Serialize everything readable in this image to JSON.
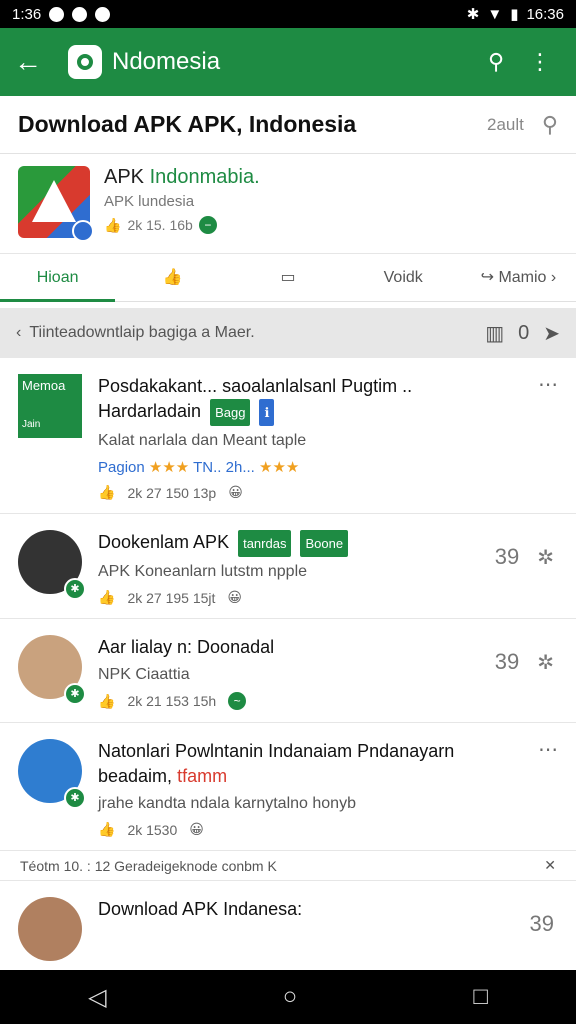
{
  "status": {
    "time": "1:36",
    "right_time": "16:36"
  },
  "appbar": {
    "title": "Ndomesia"
  },
  "search": {
    "query": "Download APK APK, Indonesia",
    "meta": "2ault"
  },
  "app": {
    "name_a": "APK",
    "name_b": "Indonmabia.",
    "sub": "APK lundesia",
    "stats": "2k  15. 16b"
  },
  "tabs": [
    {
      "label": "Hioan"
    },
    {
      "label": ""
    },
    {
      "label": ""
    },
    {
      "label": "Voidk"
    },
    {
      "label": "Mamio"
    }
  ],
  "notice": {
    "text": "Tiinteadowntlaip bagiga a Maer.",
    "count": "0"
  },
  "posts": [
    {
      "avatar_text": "Memoa",
      "avatar_sub": "Jain",
      "title": "Posdakakant... saoalanlalsanl Pugtim ..",
      "title2": "Hardarladain",
      "tag": "Bagg",
      "desc": "Kalat narlala dan Meant taple",
      "rating_label": "Pagion",
      "rating_text": "TN.. 2h...",
      "foot": "2k   27   150 13p"
    },
    {
      "title": "Dookenlam APK",
      "tag1": "tanrdas",
      "tag2": "Boone",
      "desc": "APK Koneanlarn lutstm npple",
      "side_num": "39",
      "foot": "2k   27   195 15jt"
    },
    {
      "title": "Aar lialay n: Doonadal",
      "desc": "NPK Ciaattia",
      "side_num": "39",
      "foot": "2k   21   153 15h"
    },
    {
      "title": "Natonlari Powlntanin Indanaiam Pndanayarn",
      "title2": "beadaim,",
      "title2_red": "tfamm",
      "desc": "jrahe kandta ndala karnytalno honyb",
      "foot": "2k   1530"
    },
    {
      "title": "Download APK Indanesa:",
      "side_num": "39"
    }
  ],
  "info_strip": {
    "text": "Téotm 10. : 12 Geradeigeknode conbm K"
  }
}
